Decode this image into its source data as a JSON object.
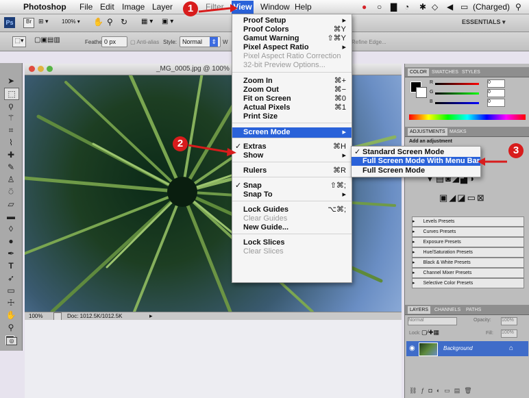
{
  "menubar": {
    "apple": "",
    "app_name": "Photoshop",
    "items": [
      "File",
      "Edit",
      "Image",
      "Layer"
    ],
    "view": "View",
    "window": "Window",
    "help": "Help",
    "charged": "(Charged)"
  },
  "appbar": {
    "ps_logo": "Ps",
    "zoom": "100%",
    "essentials": "ESSENTIALS ▾"
  },
  "optbar": {
    "feather_label": "Feather:",
    "feather_value": "0 px",
    "antialias": "Anti-alias",
    "style_label": "Style:",
    "style_value": "Normal",
    "refine": "Refine Edge..."
  },
  "document": {
    "title": "_MG_0005.jpg @ 100%",
    "zoom": "100%",
    "doc_info": "Doc: 1012.5K/1012.5K"
  },
  "view_menu": {
    "items": [
      {
        "label": "Proof Setup",
        "shortcut": "▸",
        "bold": true
      },
      {
        "label": "Proof Colors",
        "shortcut": "⌘Y",
        "bold": true
      },
      {
        "label": "Gamut Warning",
        "shortcut": "⇧⌘Y",
        "bold": true
      },
      {
        "label": "Pixel Aspect Ratio",
        "shortcut": "▸",
        "bold": true
      },
      {
        "label": "Pixel Aspect Ratio Correction",
        "shortcut": "",
        "disabled": true
      },
      {
        "label": "32-bit Preview Options...",
        "shortcut": "",
        "disabled": true
      },
      {
        "label": "Zoom In",
        "shortcut": "⌘+",
        "bold": true
      },
      {
        "label": "Zoom Out",
        "shortcut": "⌘−",
        "bold": true
      },
      {
        "label": "Fit on Screen",
        "shortcut": "⌘0",
        "bold": true
      },
      {
        "label": "Actual Pixels",
        "shortcut": "⌘1",
        "bold": true
      },
      {
        "label": "Print Size",
        "shortcut": "",
        "bold": true
      },
      {
        "label": "Screen Mode",
        "shortcut": "▸",
        "highlight": true
      },
      {
        "label": "Extras",
        "shortcut": "⌘H",
        "bold": true,
        "check": "✓"
      },
      {
        "label": "Show",
        "shortcut": "▸",
        "bold": true
      },
      {
        "label": "Rulers",
        "shortcut": "⌘R",
        "bold": true
      },
      {
        "label": "Snap",
        "shortcut": "⇧⌘;",
        "bold": true,
        "check": "✓"
      },
      {
        "label": "Snap To",
        "shortcut": "▸",
        "bold": true
      },
      {
        "label": "Lock Guides",
        "shortcut": "⌥⌘;",
        "bold": true
      },
      {
        "label": "Clear Guides",
        "shortcut": "",
        "disabled": true
      },
      {
        "label": "New Guide...",
        "shortcut": "",
        "bold": true
      },
      {
        "label": "Lock Slices",
        "shortcut": "",
        "bold": true
      },
      {
        "label": "Clear Slices",
        "shortcut": "",
        "disabled": true
      }
    ]
  },
  "screen_mode_menu": {
    "items": [
      {
        "label": "Standard Screen Mode",
        "check": "✓"
      },
      {
        "label": "Full Screen Mode With Menu Bar",
        "highlight": true
      },
      {
        "label": "Full Screen Mode"
      }
    ]
  },
  "callouts": [
    "1",
    "2",
    "3"
  ],
  "panels": {
    "color_tabs": [
      "COLOR",
      "SWATCHES",
      "STYLES"
    ],
    "color_channels": [
      {
        "label": "R",
        "value": "0"
      },
      {
        "label": "G",
        "value": "0"
      },
      {
        "label": "B",
        "value": "0"
      }
    ],
    "adjust_tabs": [
      "ADJUSTMENTS",
      "MASKS"
    ],
    "add_adjustment": "Add an adjustment",
    "presets": [
      "Levels Presets",
      "Curves Presets",
      "Exposure Presets",
      "Hue/Saturation Presets",
      "Black & White Presets",
      "Channel Mixer Presets",
      "Selective Color Presets"
    ],
    "layers_tabs": [
      "LAYERS",
      "CHANNELS",
      "PATHS"
    ],
    "blend_mode": "Normal",
    "opacity_label": "Opacity:",
    "opacity_value": "100%",
    "lock_label": "Lock:",
    "fill_label": "Fill:",
    "fill_value": "100%",
    "layer_name": "Background"
  },
  "colors": {
    "accent": "#2a62d9",
    "callout": "#d81c1c"
  }
}
